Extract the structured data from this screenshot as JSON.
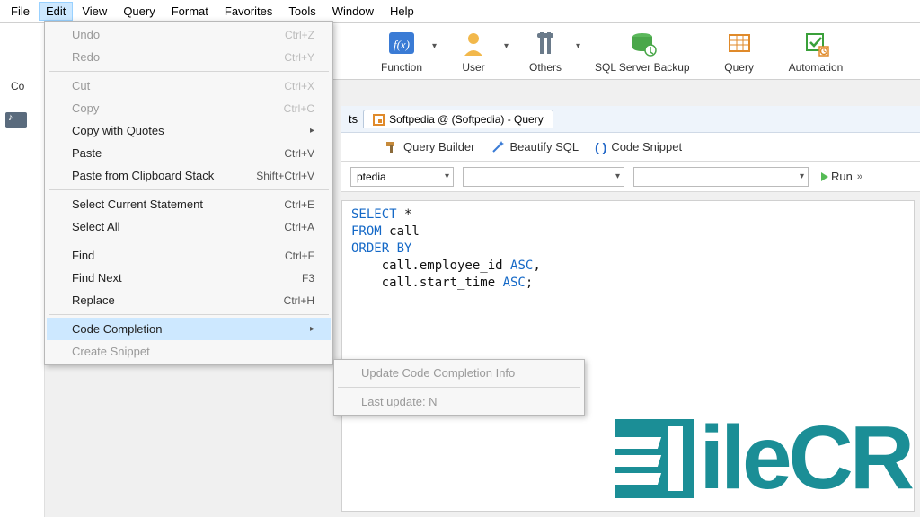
{
  "menubar": [
    "File",
    "Edit",
    "View",
    "Query",
    "Format",
    "Favorites",
    "Tools",
    "Window",
    "Help"
  ],
  "toolbar": {
    "function": "Function",
    "user": "User",
    "others": "Others",
    "backup": "SQL Server Backup",
    "query": "Query",
    "automation": "Automation"
  },
  "leftStrip": {
    "label": "Co"
  },
  "tab": {
    "title": "Softpedia @ (Softpedia) - Query",
    "ts": "ts"
  },
  "querybar": {
    "builder": "Query Builder",
    "beautify": "Beautify SQL",
    "snippet": "Code Snippet"
  },
  "selects": {
    "s1": "ptedia"
  },
  "run": {
    "label": "Run"
  },
  "sql": {
    "l1_kw": "SELECT",
    "l1_rest": " *",
    "l2_kw": "FROM",
    "l2_rest": " call",
    "l3_kw": "ORDER BY",
    "l4_pre": "    call.employee_id ",
    "l4_kw": "ASC",
    "l4_rest": ",",
    "l5_pre": "    call.start_time ",
    "l5_kw": "ASC",
    "l5_rest": ";"
  },
  "editMenu": {
    "undo": {
      "label": "Undo",
      "sc": "Ctrl+Z"
    },
    "redo": {
      "label": "Redo",
      "sc": "Ctrl+Y"
    },
    "cut": {
      "label": "Cut",
      "sc": "Ctrl+X"
    },
    "copy": {
      "label": "Copy",
      "sc": "Ctrl+C"
    },
    "copyq": {
      "label": "Copy with Quotes"
    },
    "paste": {
      "label": "Paste",
      "sc": "Ctrl+V"
    },
    "pasteclip": {
      "label": "Paste from Clipboard Stack",
      "sc": "Shift+Ctrl+V"
    },
    "selstmt": {
      "label": "Select Current Statement",
      "sc": "Ctrl+E"
    },
    "selall": {
      "label": "Select All",
      "sc": "Ctrl+A"
    },
    "find": {
      "label": "Find",
      "sc": "Ctrl+F"
    },
    "findnext": {
      "label": "Find Next",
      "sc": "F3"
    },
    "replace": {
      "label": "Replace",
      "sc": "Ctrl+H"
    },
    "codecomp": {
      "label": "Code Completion"
    },
    "createsnip": {
      "label": "Create Snippet"
    }
  },
  "subMenu": {
    "update": "Update Code Completion Info",
    "last": "Last update: N"
  },
  "watermark": "ileCR"
}
